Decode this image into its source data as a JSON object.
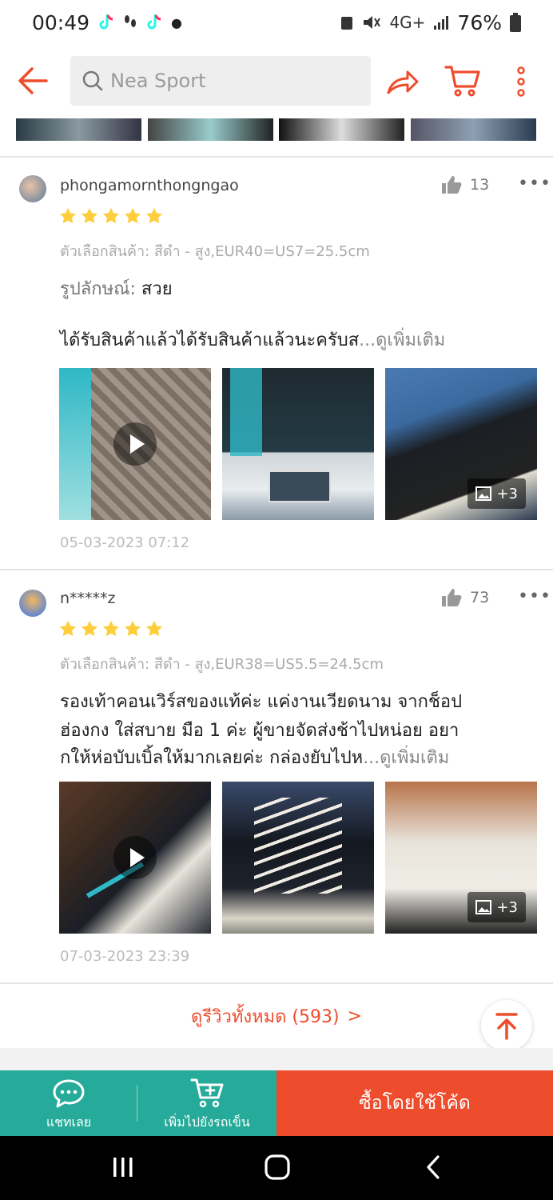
{
  "status_bar": {
    "time": "00:49",
    "battery": "76%",
    "network": "4G+"
  },
  "header": {
    "search_placeholder": "Nea Sport"
  },
  "reviews": [
    {
      "username": "phongamornthongngao",
      "likes": "13",
      "rating": 5,
      "variant": "ตัวเลือกสินค้า: สีดำ - สูง,EUR40=US7=25.5cm",
      "appearance_label": "รูปลักษณ์:",
      "appearance_value": "สวย",
      "text_lines": [
        "ได้รับสินค้าแล้วได้รับสินค้าแล้วนะครับส"
      ],
      "text_tail": "...",
      "more_label": "ดูเพิ่มเติม",
      "extra_photos": "+3",
      "date": "05-03-2023 07:12"
    },
    {
      "username": "n*****z",
      "likes": "73",
      "rating": 5,
      "variant": "ตัวเลือกสินค้า: สีดำ - สูง,EUR38=US5.5=24.5cm",
      "text_lines": [
        "รองเท้าคอนเวิร์สของแท้ค่ะ แค่งานเวียดนาม จากช็อป",
        "ฮ่องกง ใส่สบาย มือ 1 ค่ะ ผู้ขายจัดส่งช้าไปหน่อย อยา",
        "กให้ห่อบับเบิ้ลให้มากเลยค่ะ กล่องยับไปห"
      ],
      "text_tail": "...",
      "more_label": "ดูเพิ่มเติม",
      "extra_photos": "+3",
      "date": "07-03-2023 23:39"
    }
  ],
  "see_all": {
    "label": "ดูรีวิวทั้งหมด (593)",
    "chevron": ">"
  },
  "bottom_bar": {
    "chat_label": "แชทเลย",
    "add_cart_label": "เพิ่มไปยังรถเข็น",
    "buy_label": "ซื้อโดยใช้โค้ด"
  },
  "colors": {
    "brand": "#ee4d2d",
    "teal": "#26aa99",
    "star": "#ffce3d"
  }
}
